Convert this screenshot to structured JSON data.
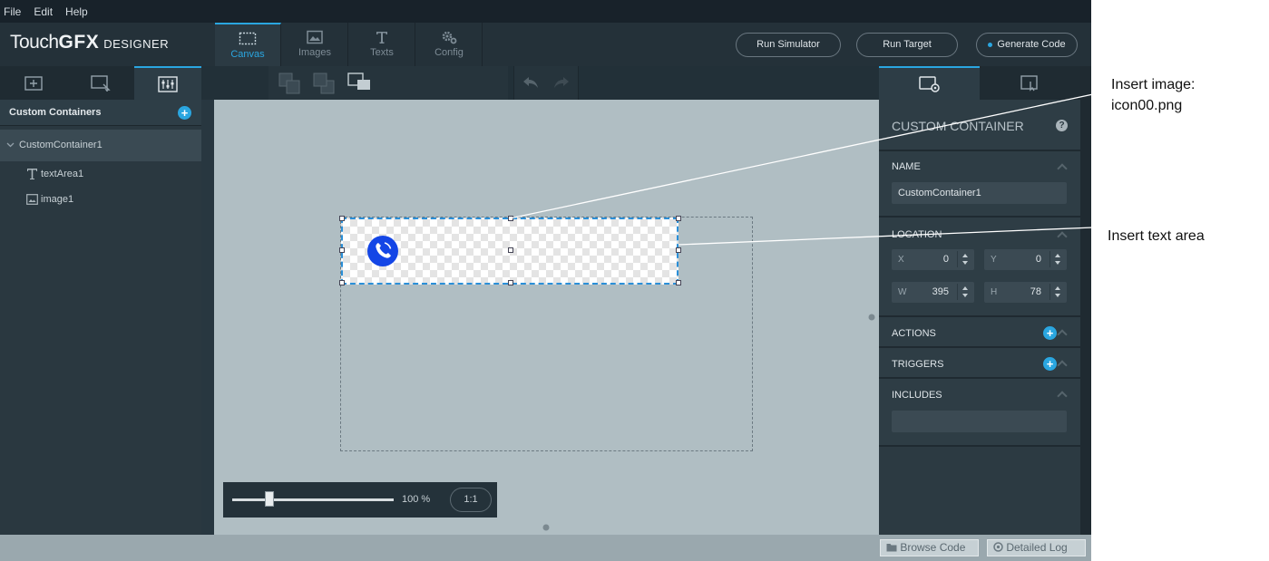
{
  "menu": [
    "File",
    "Edit",
    "Help"
  ],
  "logo": {
    "part1": "Touch",
    "part2": "GFX",
    "part3": "DESIGNER"
  },
  "main_tabs": [
    {
      "label": "Canvas",
      "icon": "canvas-icon",
      "active": true
    },
    {
      "label": "Images",
      "icon": "image-icon",
      "active": false
    },
    {
      "label": "Texts",
      "icon": "text-icon",
      "active": false
    },
    {
      "label": "Config",
      "icon": "gear-icon",
      "active": false
    }
  ],
  "header_buttons": {
    "run_simulator": "Run Simulator",
    "run_target": "Run Target",
    "generate_code": "Generate Code"
  },
  "left_panel": {
    "title": "Custom Containers",
    "tree": {
      "root": "CustomContainer1",
      "children": [
        "textArea1",
        "image1"
      ]
    }
  },
  "canvas": {
    "zoom_label": "100 %",
    "zoom_reset": "1:1",
    "zoom_percent": 100
  },
  "right_panel": {
    "title": "CUSTOM CONTAINER",
    "name_section": "NAME",
    "name_value": "CustomContainer1",
    "location_section": "LOCATION",
    "fields": {
      "x": {
        "label": "X",
        "value": "0"
      },
      "y": {
        "label": "Y",
        "value": "0"
      },
      "w": {
        "label": "W",
        "value": "395"
      },
      "h": {
        "label": "H",
        "value": "78"
      }
    },
    "actions": "ACTIONS",
    "triggers": "TRIGGERS",
    "includes": "INCLUDES"
  },
  "status_bar": {
    "browse_code": "Browse Code",
    "detailed_log": "Detailed Log"
  },
  "annotations": {
    "insert_image_line1": "Insert image:",
    "insert_image_line2": "icon00.png",
    "insert_text": "Insert text area"
  },
  "colors": {
    "accent": "#2aa6e0",
    "icon_blue": "#1446e6"
  }
}
